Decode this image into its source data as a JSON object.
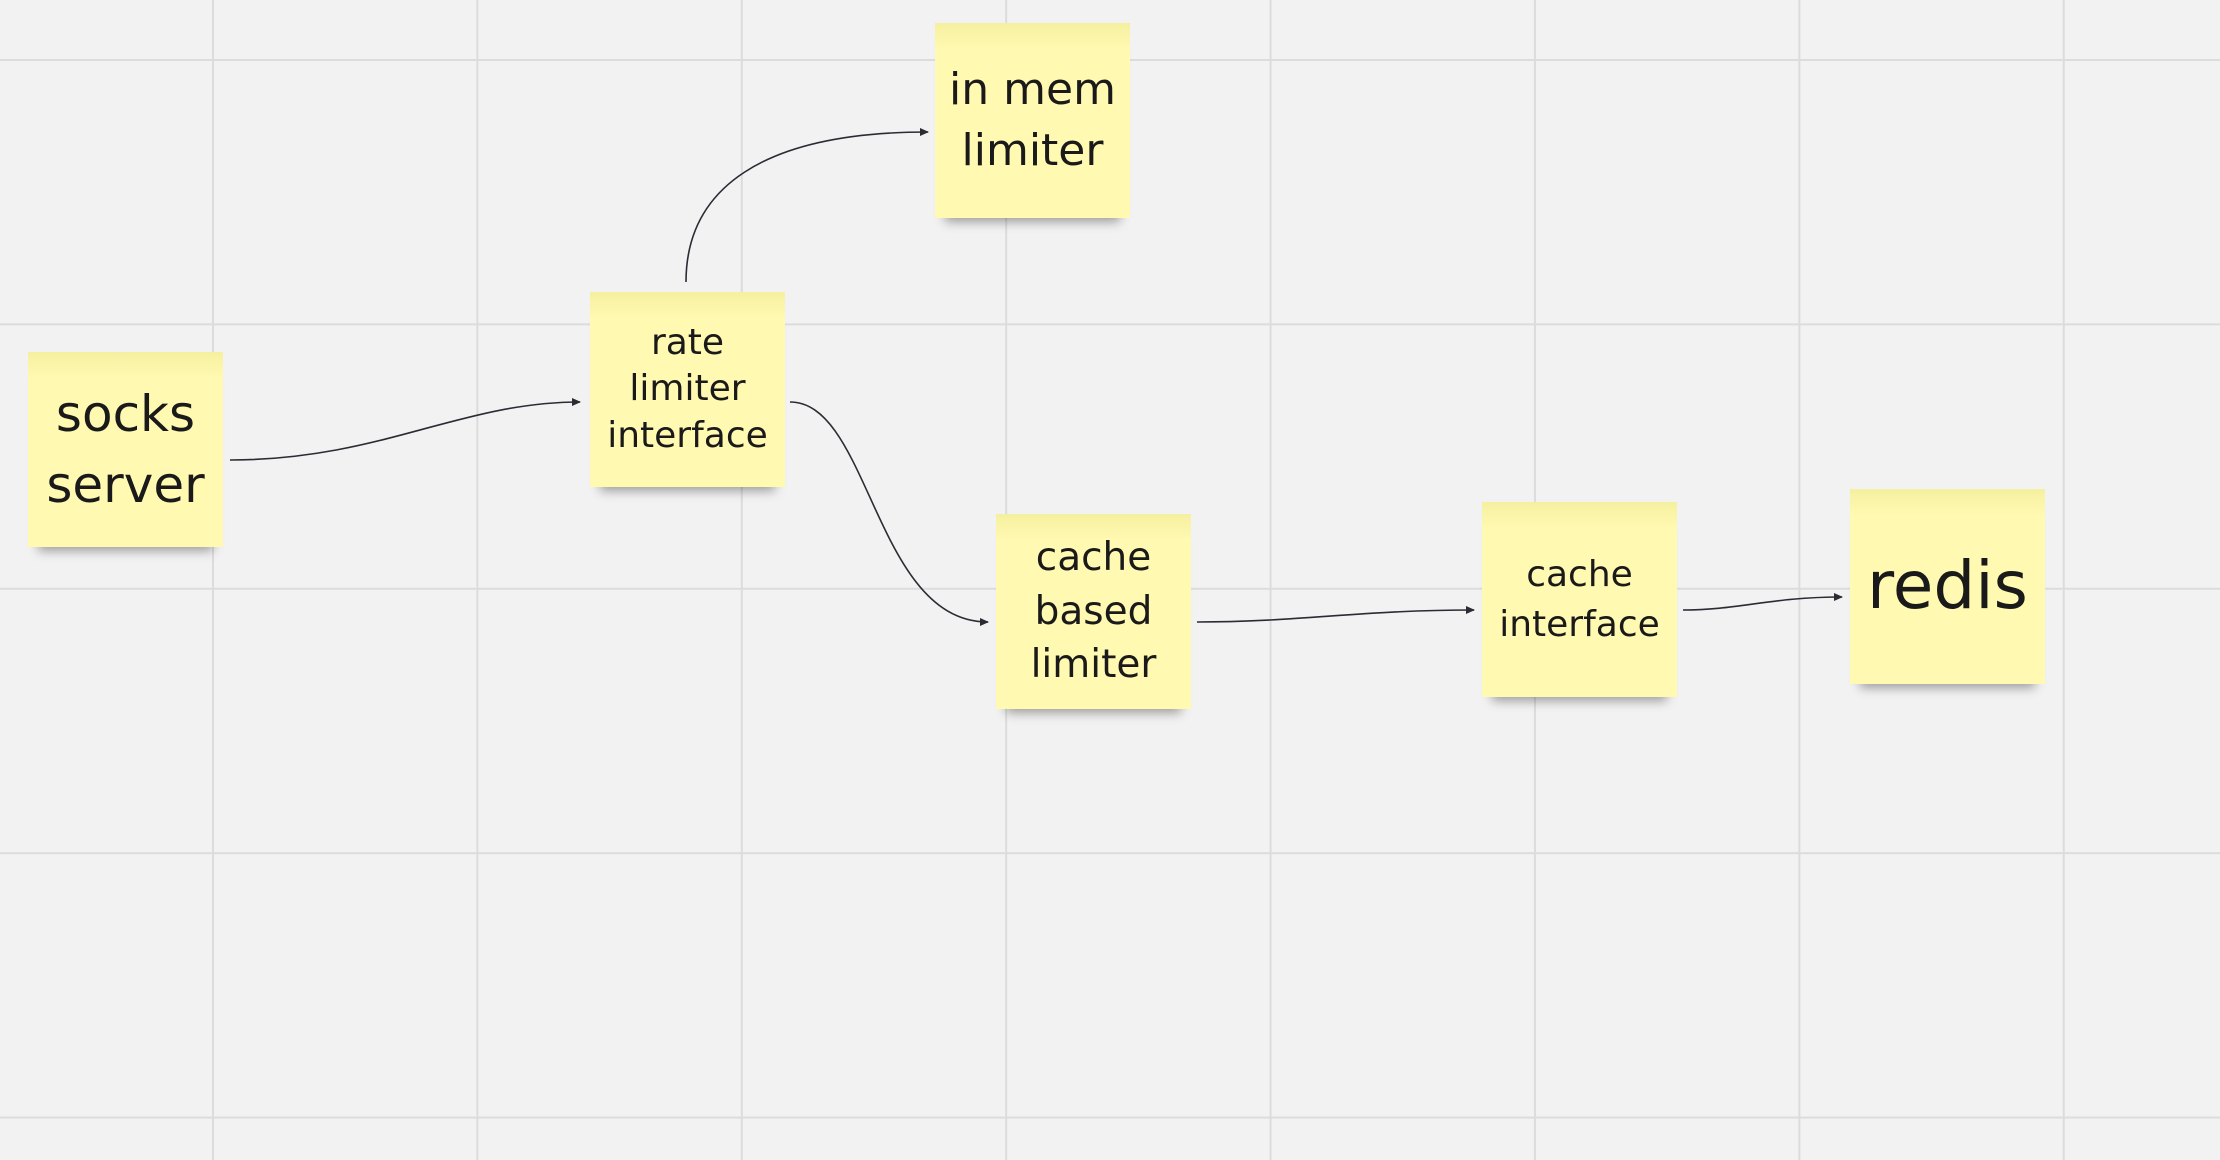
{
  "nodes": {
    "socks_server": {
      "label": "socks server"
    },
    "rate_limiter_interface": {
      "label": "rate limiter interface"
    },
    "in_mem_limiter": {
      "label": "in mem limiter"
    },
    "cache_based_limiter": {
      "label": "cache based limiter"
    },
    "cache_interface": {
      "label": "cache interface"
    },
    "redis": {
      "label": "redis"
    }
  },
  "edges": [
    {
      "from": "socks server",
      "to": "rate limiter interface"
    },
    {
      "from": "rate limiter interface",
      "to": "in mem limiter"
    },
    {
      "from": "rate limiter interface",
      "to": "cache based limiter"
    },
    {
      "from": "cache based limiter",
      "to": "cache interface"
    },
    {
      "from": "cache interface",
      "to": "redis"
    }
  ],
  "colors": {
    "sticky_note": "#fff9b1",
    "canvas": "#f2f2f2",
    "grid_line": "#dcdcdc",
    "connector": "#2b2b34"
  }
}
